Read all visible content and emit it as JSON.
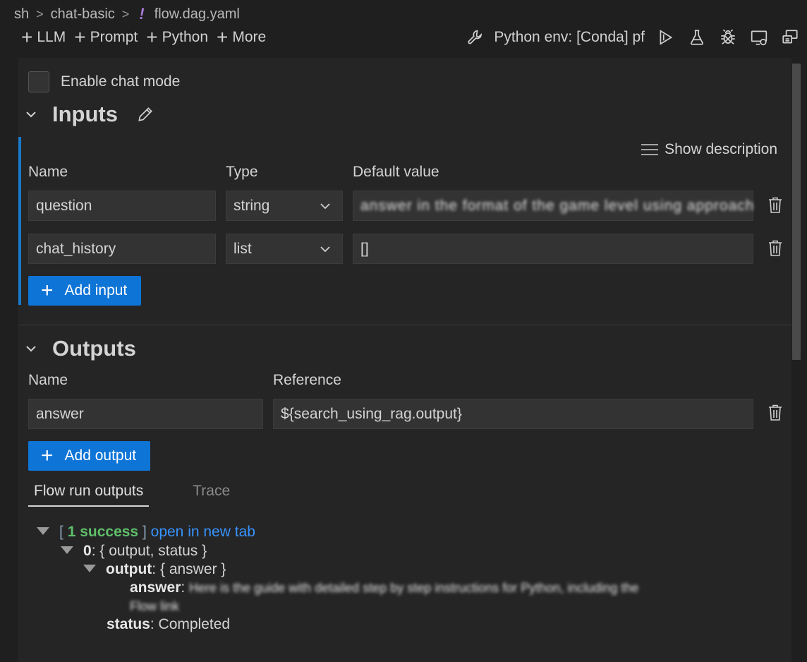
{
  "breadcrumb": {
    "items": [
      "sh",
      "chat-basic",
      "flow.dag.yaml"
    ],
    "separator": ">",
    "yaml_icon": "!"
  },
  "toolbar": {
    "add_buttons": [
      {
        "label": "LLM"
      },
      {
        "label": "Prompt"
      },
      {
        "label": "Python"
      },
      {
        "label": "More"
      }
    ],
    "env_label": "Python env: [Conda] pf",
    "icons": [
      "wrench-icon",
      "run-icon",
      "test-icon",
      "debug-icon",
      "deploy-icon",
      "layout-icon"
    ]
  },
  "chat_mode": {
    "label": "Enable chat mode",
    "checked": false
  },
  "inputs": {
    "title": "Inputs",
    "show_description": "Show description",
    "columns": {
      "name": "Name",
      "type": "Type",
      "default": "Default value"
    },
    "rows": [
      {
        "name": "question",
        "type": "string",
        "default": "answer in the format of the game level using approach"
      },
      {
        "name": "chat_history",
        "type": "list",
        "default": "[]"
      }
    ],
    "add_label": "Add input"
  },
  "outputs": {
    "title": "Outputs",
    "columns": {
      "name": "Name",
      "reference": "Reference"
    },
    "rows": [
      {
        "name": "answer",
        "reference": "${search_using_rag.output}"
      }
    ],
    "add_label": "Add output"
  },
  "tabs": {
    "active": "Flow run outputs",
    "inactive": "Trace"
  },
  "run_output": {
    "open_bracket": "[",
    "success": "1 success",
    "close_bracket": "]",
    "open_link": "open in new tab",
    "item_key": "0",
    "item_summary": ": { output, status }",
    "output_key": "output",
    "output_summary": ": { answer }",
    "answer_key": "answer",
    "answer_value_line1": "Here is the guide with detailed step by step instructions for Python, including the",
    "answer_value_line2": "Flow link",
    "status_key": "status",
    "status_value": ": Completed"
  },
  "colors": {
    "accent": "#0e74d6",
    "success": "#5fbf6a",
    "link": "#3794ff",
    "inputs_bar": "#1a79c8"
  }
}
